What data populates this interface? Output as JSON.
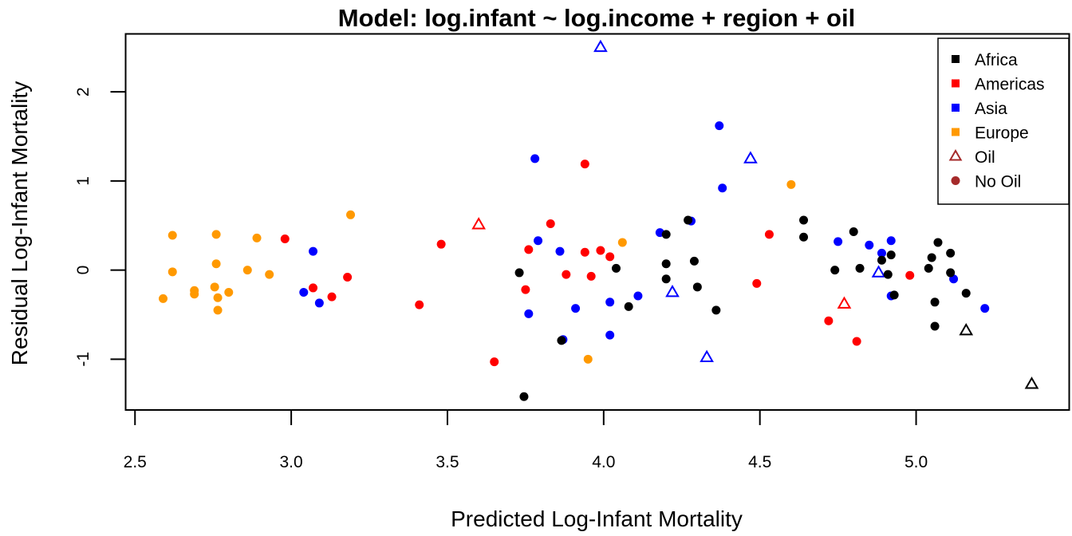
{
  "chart_data": {
    "type": "scatter",
    "title": "Model: log.infant ~ log.income + region + oil",
    "xlabel": "Predicted Log-Infant Mortality",
    "ylabel": "Residual Log-Infant Mortality",
    "xlim": [
      2.47,
      5.49
    ],
    "ylim": [
      -1.57,
      2.65
    ],
    "x_ticks": [
      2.5,
      3.0,
      3.5,
      4.0,
      4.5,
      5.0
    ],
    "x_tick_labels": [
      "2.5",
      "3.0",
      "3.5",
      "4.0",
      "4.5",
      "5.0"
    ],
    "y_ticks": [
      -1,
      0,
      1,
      2
    ],
    "y_tick_labels": [
      "-1",
      "0",
      "1",
      "2"
    ],
    "grid": false,
    "legend_position": "top-right",
    "legend": [
      {
        "label": "Africa",
        "symbol": "square",
        "color": "#000000"
      },
      {
        "label": "Americas",
        "symbol": "square",
        "color": "#ff0000"
      },
      {
        "label": "Asia",
        "symbol": "square",
        "color": "#0000ff"
      },
      {
        "label": "Europe",
        "symbol": "square",
        "color": "#ff9900"
      },
      {
        "label": "Oil",
        "symbol": "triangle-open",
        "color": "#a52a2a"
      },
      {
        "label": "No Oil",
        "symbol": "circle",
        "color": "#a52a2a"
      }
    ],
    "series": [
      {
        "name": "Europe",
        "color": "#ff9900",
        "points": [
          {
            "x": 2.59,
            "y": -0.32,
            "oil": false
          },
          {
            "x": 2.62,
            "y": 0.39,
            "oil": false
          },
          {
            "x": 2.62,
            "y": -0.02,
            "oil": false
          },
          {
            "x": 2.69,
            "y": -0.23,
            "oil": false
          },
          {
            "x": 2.69,
            "y": -0.27,
            "oil": false
          },
          {
            "x": 2.76,
            "y": 0.4,
            "oil": false
          },
          {
            "x": 2.76,
            "y": 0.07,
            "oil": false
          },
          {
            "x": 2.755,
            "y": -0.19,
            "oil": false
          },
          {
            "x": 2.765,
            "y": -0.31,
            "oil": false
          },
          {
            "x": 2.765,
            "y": -0.45,
            "oil": false
          },
          {
            "x": 2.8,
            "y": -0.25,
            "oil": false
          },
          {
            "x": 2.86,
            "y": 0.0,
            "oil": false
          },
          {
            "x": 2.89,
            "y": 0.36,
            "oil": false
          },
          {
            "x": 2.93,
            "y": -0.05,
            "oil": false
          },
          {
            "x": 3.19,
            "y": 0.62,
            "oil": false
          },
          {
            "x": 3.95,
            "y": -1.0,
            "oil": false
          },
          {
            "x": 4.06,
            "y": 0.31,
            "oil": false
          },
          {
            "x": 4.6,
            "y": 0.96,
            "oil": false
          }
        ]
      },
      {
        "name": "Americas",
        "color": "#ff0000",
        "points": [
          {
            "x": 2.98,
            "y": 0.35,
            "oil": false
          },
          {
            "x": 3.07,
            "y": -0.2,
            "oil": false
          },
          {
            "x": 3.13,
            "y": -0.3,
            "oil": false
          },
          {
            "x": 3.18,
            "y": -0.08,
            "oil": false
          },
          {
            "x": 3.41,
            "y": -0.39,
            "oil": false
          },
          {
            "x": 3.48,
            "y": 0.29,
            "oil": false
          },
          {
            "x": 3.6,
            "y": 0.51,
            "oil": true
          },
          {
            "x": 3.65,
            "y": -1.03,
            "oil": false
          },
          {
            "x": 3.75,
            "y": -0.22,
            "oil": false
          },
          {
            "x": 3.76,
            "y": 0.23,
            "oil": false
          },
          {
            "x": 3.83,
            "y": 0.52,
            "oil": false
          },
          {
            "x": 3.88,
            "y": -0.05,
            "oil": false
          },
          {
            "x": 3.94,
            "y": 1.19,
            "oil": false
          },
          {
            "x": 3.94,
            "y": 0.2,
            "oil": false
          },
          {
            "x": 3.96,
            "y": -0.07,
            "oil": false
          },
          {
            "x": 3.99,
            "y": 0.22,
            "oil": false
          },
          {
            "x": 4.02,
            "y": 0.15,
            "oil": false
          },
          {
            "x": 4.49,
            "y": -0.15,
            "oil": false
          },
          {
            "x": 4.53,
            "y": 0.4,
            "oil": false
          },
          {
            "x": 4.72,
            "y": -0.57,
            "oil": false
          },
          {
            "x": 4.77,
            "y": -0.38,
            "oil": true
          },
          {
            "x": 4.81,
            "y": -0.8,
            "oil": false
          },
          {
            "x": 4.98,
            "y": -0.06,
            "oil": false
          }
        ]
      },
      {
        "name": "Asia",
        "color": "#0000ff",
        "points": [
          {
            "x": 3.04,
            "y": -0.25,
            "oil": false
          },
          {
            "x": 3.07,
            "y": 0.21,
            "oil": false
          },
          {
            "x": 3.09,
            "y": -0.37,
            "oil": false
          },
          {
            "x": 3.76,
            "y": -0.49,
            "oil": false
          },
          {
            "x": 3.78,
            "y": 1.25,
            "oil": false
          },
          {
            "x": 3.79,
            "y": 0.33,
            "oil": false
          },
          {
            "x": 3.86,
            "y": 0.21,
            "oil": false
          },
          {
            "x": 3.87,
            "y": -0.78,
            "oil": false
          },
          {
            "x": 3.91,
            "y": -0.43,
            "oil": false
          },
          {
            "x": 3.99,
            "y": 2.5,
            "oil": true
          },
          {
            "x": 4.02,
            "y": -0.36,
            "oil": false
          },
          {
            "x": 4.02,
            "y": -0.73,
            "oil": false
          },
          {
            "x": 4.11,
            "y": -0.29,
            "oil": false
          },
          {
            "x": 4.18,
            "y": 0.42,
            "oil": false
          },
          {
            "x": 4.22,
            "y": -0.25,
            "oil": true
          },
          {
            "x": 4.28,
            "y": 0.55,
            "oil": false
          },
          {
            "x": 4.33,
            "y": -0.98,
            "oil": true
          },
          {
            "x": 4.37,
            "y": 1.62,
            "oil": false
          },
          {
            "x": 4.38,
            "y": 0.92,
            "oil": false
          },
          {
            "x": 4.47,
            "y": 1.25,
            "oil": true
          },
          {
            "x": 4.75,
            "y": 0.32,
            "oil": false
          },
          {
            "x": 4.85,
            "y": 0.28,
            "oil": false
          },
          {
            "x": 4.88,
            "y": -0.03,
            "oil": true
          },
          {
            "x": 4.89,
            "y": 0.19,
            "oil": false
          },
          {
            "x": 4.92,
            "y": 0.33,
            "oil": false
          },
          {
            "x": 4.92,
            "y": -0.29,
            "oil": false
          },
          {
            "x": 5.12,
            "y": -0.1,
            "oil": false
          },
          {
            "x": 5.22,
            "y": -0.43,
            "oil": false
          }
        ]
      },
      {
        "name": "Africa",
        "color": "#000000",
        "points": [
          {
            "x": 3.73,
            "y": -0.03,
            "oil": false
          },
          {
            "x": 3.745,
            "y": -1.42,
            "oil": false
          },
          {
            "x": 3.865,
            "y": -0.79,
            "oil": false
          },
          {
            "x": 4.04,
            "y": 0.02,
            "oil": false
          },
          {
            "x": 4.08,
            "y": -0.41,
            "oil": false
          },
          {
            "x": 4.2,
            "y": 0.4,
            "oil": false
          },
          {
            "x": 4.2,
            "y": 0.07,
            "oil": false
          },
          {
            "x": 4.2,
            "y": -0.1,
            "oil": false
          },
          {
            "x": 4.27,
            "y": 0.56,
            "oil": false
          },
          {
            "x": 4.29,
            "y": 0.1,
            "oil": false
          },
          {
            "x": 4.3,
            "y": -0.19,
            "oil": false
          },
          {
            "x": 4.36,
            "y": -0.45,
            "oil": false
          },
          {
            "x": 4.64,
            "y": 0.56,
            "oil": false
          },
          {
            "x": 4.64,
            "y": 0.37,
            "oil": false
          },
          {
            "x": 4.74,
            "y": 0.0,
            "oil": false
          },
          {
            "x": 4.8,
            "y": 0.43,
            "oil": false
          },
          {
            "x": 4.82,
            "y": 0.02,
            "oil": false
          },
          {
            "x": 4.89,
            "y": 0.11,
            "oil": false
          },
          {
            "x": 4.91,
            "y": -0.05,
            "oil": false
          },
          {
            "x": 4.92,
            "y": 0.17,
            "oil": false
          },
          {
            "x": 4.93,
            "y": -0.28,
            "oil": false
          },
          {
            "x": 5.04,
            "y": 0.02,
            "oil": false
          },
          {
            "x": 5.05,
            "y": 0.14,
            "oil": false
          },
          {
            "x": 5.06,
            "y": -0.36,
            "oil": false
          },
          {
            "x": 5.06,
            "y": -0.63,
            "oil": false
          },
          {
            "x": 5.07,
            "y": 0.31,
            "oil": false
          },
          {
            "x": 5.11,
            "y": 0.19,
            "oil": false
          },
          {
            "x": 5.11,
            "y": -0.03,
            "oil": false
          },
          {
            "x": 5.16,
            "y": -0.26,
            "oil": false
          },
          {
            "x": 5.16,
            "y": -0.68,
            "oil": true
          },
          {
            "x": 5.37,
            "y": -1.28,
            "oil": true
          }
        ]
      }
    ]
  }
}
